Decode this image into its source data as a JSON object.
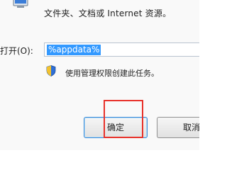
{
  "dialog": {
    "description": "文件夹、文档或 Internet 资源。",
    "open_label": "打开(O):",
    "open_value": "%appdata%",
    "admin_note": "使用管理权限创建此任务。",
    "ok_label": "确定",
    "cancel_label": "取消"
  },
  "icons": {
    "run_icon": "run-dialog-icon",
    "shield": "uac-shield-icon"
  },
  "colors": {
    "selection": "#3399ff",
    "highlight_box": "#e8322b",
    "ok_border": "#3a8ad6"
  }
}
